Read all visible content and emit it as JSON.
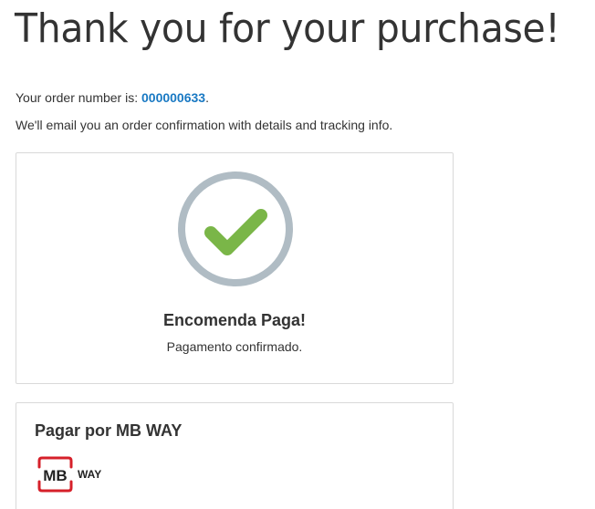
{
  "page": {
    "title": "Thank you for your purchase!"
  },
  "order": {
    "number_label": "Your order number is: ",
    "number": "000000633",
    "number_suffix": ".",
    "email_note": "We'll email you an order confirmation with details and tracking info."
  },
  "status_card": {
    "icon": "checkmark-circle-icon",
    "title": "Encomenda Paga!",
    "text": "Pagamento confirmado."
  },
  "payment_card": {
    "title": "Pagar por MB WAY",
    "logo": "mbway-logo",
    "logo_text_mb": "MB",
    "logo_text_way": "WAY"
  },
  "colors": {
    "link": "#1979c3",
    "check": "#7ab648",
    "ring": "#b0bcc4",
    "mbway_red": "#d6202a"
  }
}
